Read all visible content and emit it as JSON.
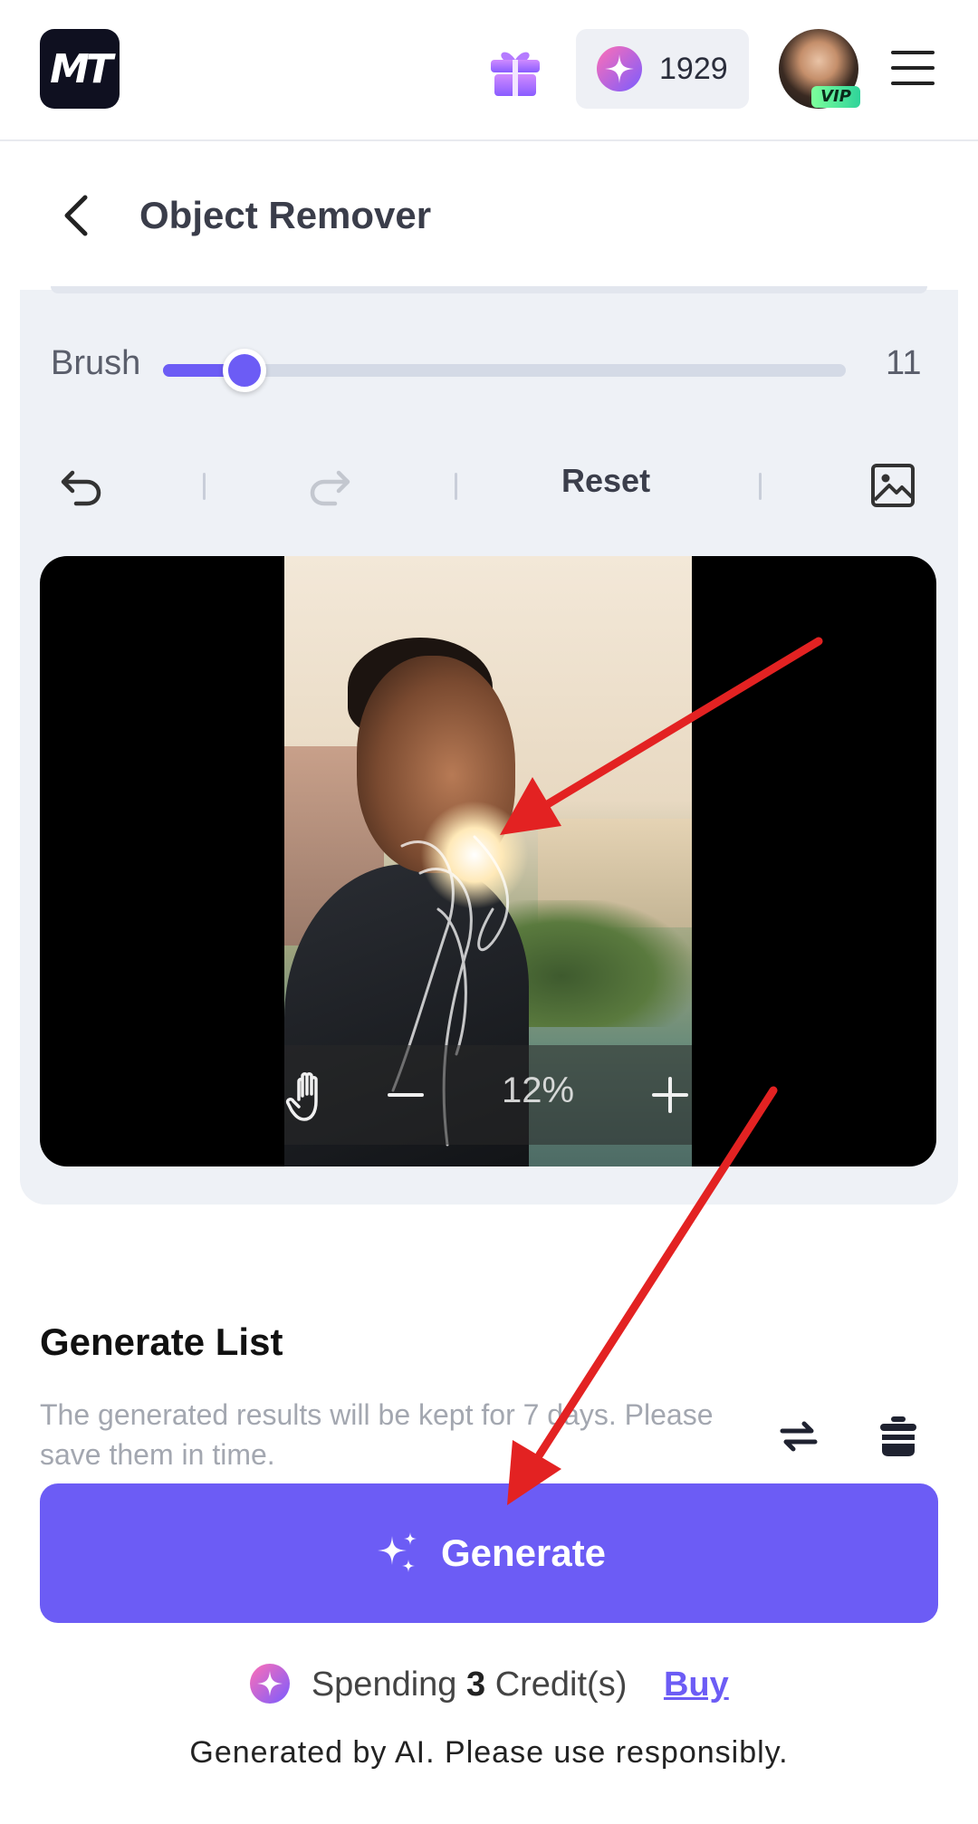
{
  "header": {
    "logo_text": "MT",
    "credits_count": "1929",
    "vip_badge": "VIP",
    "icons": [
      "gift-icon",
      "spark-icon",
      "menu-icon"
    ]
  },
  "page": {
    "title": "Object Remover"
  },
  "editor": {
    "brush_label": "Brush",
    "brush_value": "11",
    "brush_level": 0.12,
    "reset_label": "Reset",
    "zoom_percent": "12%"
  },
  "generate_list": {
    "title": "Generate List",
    "description": "The generated results will be kept for 7 days. Please save them in time."
  },
  "generate_button": {
    "label": "Generate"
  },
  "spending": {
    "prefix": "Spending",
    "amount": "3",
    "suffix": "Credit(s)",
    "buy_label": "Buy"
  },
  "disclaimer": "Generated by AI. Please use responsibly.",
  "colors": {
    "accent": "#6c5cf5",
    "annotation_arrow": "#e32222"
  }
}
